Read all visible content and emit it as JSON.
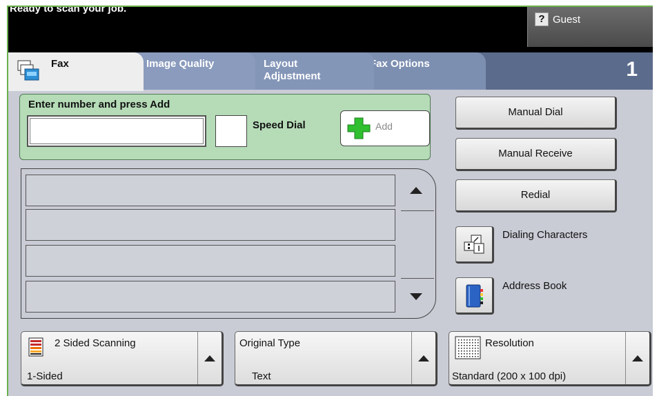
{
  "status": {
    "message": "Ready to scan your job.",
    "user_label": "Guest"
  },
  "tabs": [
    {
      "label": "Fax"
    },
    {
      "label": "Image Quality"
    },
    {
      "label": "Layout\nAdjustment"
    },
    {
      "label": "Fax Options"
    }
  ],
  "job_counter": "1",
  "entry": {
    "title": "Enter number and press Add",
    "input_value": "",
    "speed_dial_label": "Speed Dial",
    "add_label": "Add"
  },
  "recipient_list": {
    "rows": [
      "",
      "",
      "",
      ""
    ]
  },
  "side_buttons": {
    "manual_dial": "Manual Dial",
    "manual_receive": "Manual Receive",
    "redial": "Redial",
    "dialing_characters": "Dialing Characters",
    "address_book": "Address Book"
  },
  "bottom_options": [
    {
      "title": "2 Sided Scanning",
      "value": "1-Sided",
      "icon": "two-sided-scan-icon"
    },
    {
      "title": "Original Type",
      "value": "Text",
      "icon": ""
    },
    {
      "title": "Resolution",
      "value": "Standard (200 x 100 dpi)",
      "icon": "resolution-icon"
    }
  ],
  "colors": {
    "status_bg": "#000000",
    "tabbar_bg": "#5b6b8c",
    "entry_panel_bg": "#b5dbb7",
    "add_icon": "#2fbf2f"
  }
}
